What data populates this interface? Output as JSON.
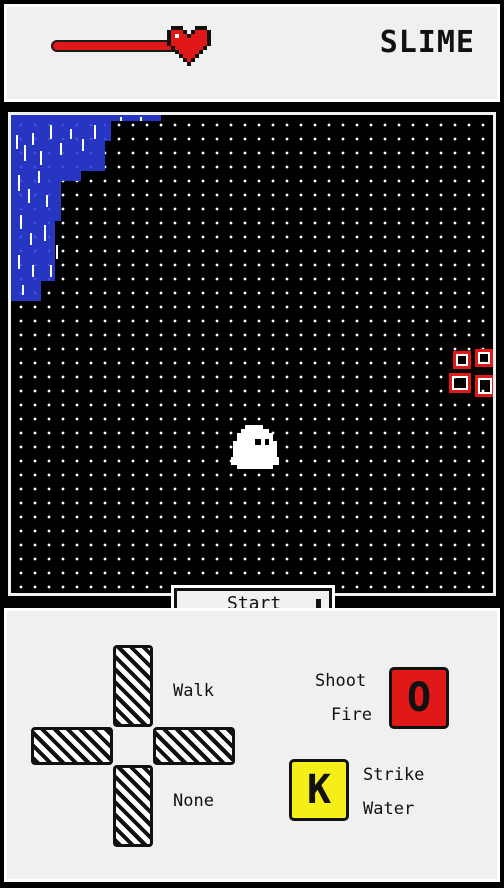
{
  "header": {
    "health": 0.85,
    "title": "SLIME"
  },
  "start_bar": {
    "label": "Start"
  },
  "controls": {
    "dpad": {
      "up_label": "Walk",
      "down_label": "None"
    },
    "fire": {
      "line1": "Shoot",
      "line2": "Fire",
      "key": "O",
      "color": "#e01818"
    },
    "water": {
      "line1": "Strike",
      "line2": "Water",
      "key": "K",
      "color": "#f5ee18"
    }
  },
  "icons": [
    "heart-icon",
    "slime-player",
    "enemy-sprite",
    "water-tile"
  ]
}
